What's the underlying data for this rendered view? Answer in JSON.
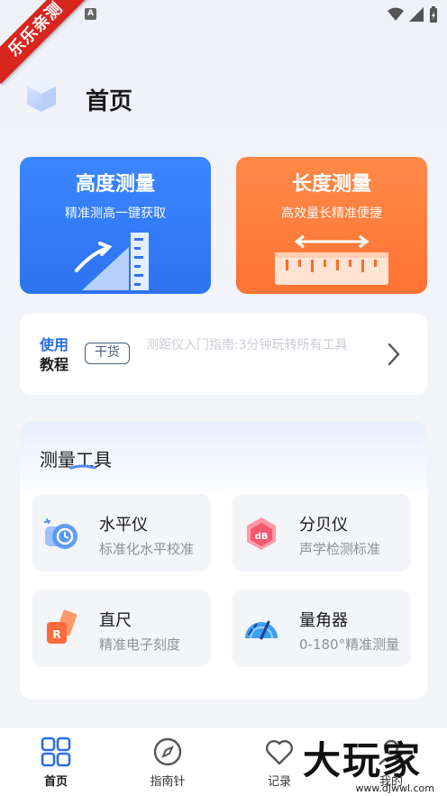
{
  "ribbon": {
    "text": "乐乐亲测"
  },
  "status_bar": {
    "notification_badge": "A"
  },
  "header": {
    "title": "首页"
  },
  "cards": {
    "height": {
      "title": "高度测量",
      "subtitle": "精准测高一键获取"
    },
    "length": {
      "title": "长度测量",
      "subtitle": "高效量长精准便捷"
    }
  },
  "tutorial": {
    "label_line1": "使用",
    "label_line2": "教程",
    "tag": "干货",
    "text": "测距仪入门指南:3分钟玩转所有工具"
  },
  "tools": {
    "title": "测量工具",
    "items": [
      {
        "name": "水平仪",
        "desc": "标准化水平校准",
        "icon": "level-icon"
      },
      {
        "name": "分贝仪",
        "desc": "声学检测标准",
        "icon": "decibel-icon"
      },
      {
        "name": "直尺",
        "desc": "精准电子刻度",
        "icon": "ruler-icon"
      },
      {
        "name": "量角器",
        "desc": "0-180°精准测量",
        "icon": "protractor-icon"
      }
    ]
  },
  "bottom_nav": [
    {
      "label": "首页",
      "icon": "home-grid-icon",
      "active": true
    },
    {
      "label": "指南针",
      "icon": "compass-icon",
      "active": false
    },
    {
      "label": "记录",
      "icon": "heart-icon",
      "active": false
    },
    {
      "label": "我的",
      "icon": "user-icon",
      "active": false
    }
  ],
  "watermark": {
    "big": "大玩家",
    "small": "www.djwwl.com"
  },
  "colors": {
    "height_card": "#2e73f0",
    "length_card": "#ff7334",
    "accent_blue": "#2b6ee6",
    "ribbon_red": "#d8261f"
  }
}
